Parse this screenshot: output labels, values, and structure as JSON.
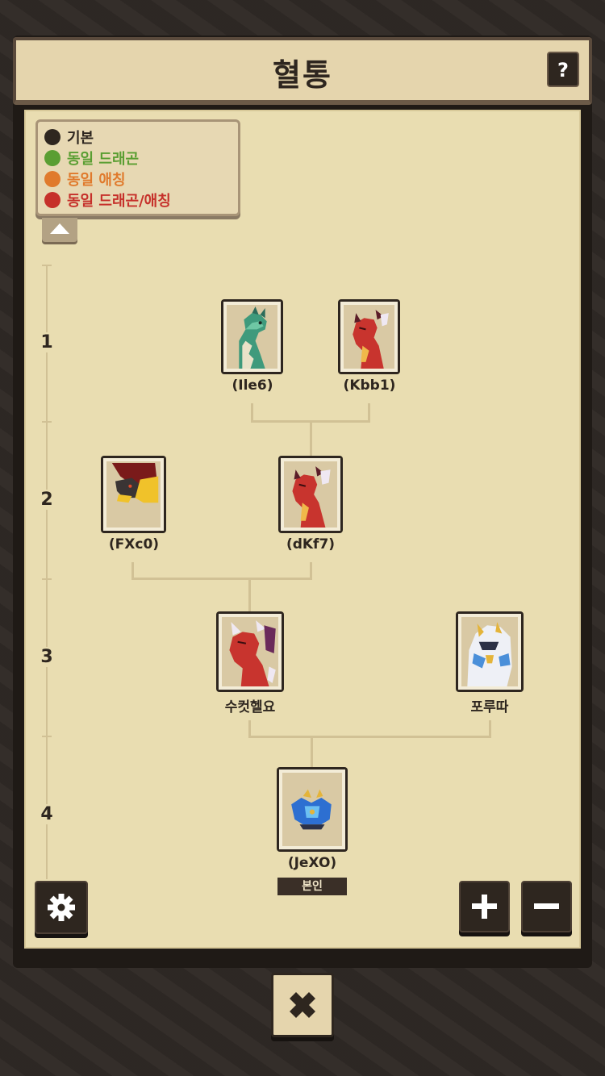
{
  "header": {
    "title": "혈통",
    "help_label": "?"
  },
  "legend": {
    "items": [
      {
        "label": "기본",
        "color": "#2e261f"
      },
      {
        "label": "동일 드래곤",
        "color": "#5a9e32"
      },
      {
        "label": "동일 애칭",
        "color": "#e07a2c"
      },
      {
        "label": "동일 드래곤/애칭",
        "color": "#c6302a"
      }
    ]
  },
  "generations": [
    "1",
    "2",
    "3",
    "4"
  ],
  "tree": {
    "gen1": [
      {
        "name": "(Ile6)",
        "icon": "green-dragon-icon"
      },
      {
        "name": "(Kbb1)",
        "icon": "red-dragon-icon"
      }
    ],
    "gen2": [
      {
        "name": "(FXc0)",
        "icon": "dark-fire-dragon-icon"
      },
      {
        "name": "(dKf7)",
        "icon": "red-dragon-icon"
      }
    ],
    "gen3": [
      {
        "name": "수컷헬요",
        "icon": "red-horned-dragon-icon"
      },
      {
        "name": "포루따",
        "icon": "white-gold-dragon-icon"
      }
    ],
    "gen4": [
      {
        "name": "(JeXO)",
        "icon": "blue-crystal-dragon-icon",
        "badge": "본인"
      }
    ]
  },
  "controls": {
    "zoom_in": "+",
    "zoom_out": "−",
    "close": "✖"
  }
}
